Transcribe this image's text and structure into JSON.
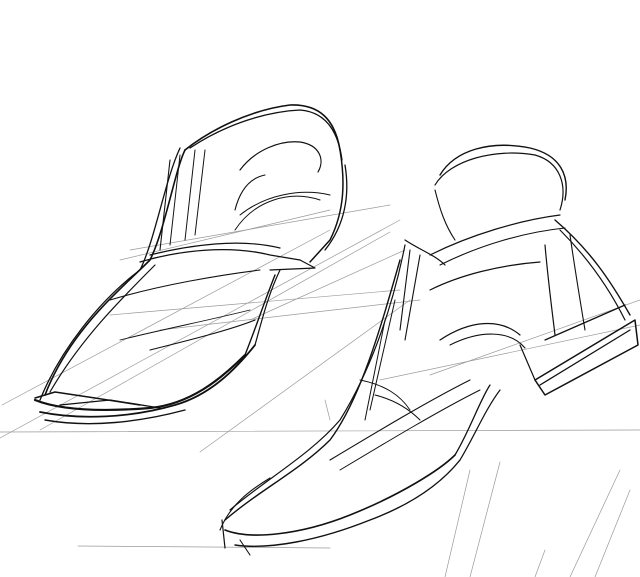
{
  "scene": {
    "background_color": "#ffffff",
    "ink_color": "#111111",
    "light_ink_color": "#888888",
    "subjects": [
      {
        "name": "left-shoe-sketch"
      },
      {
        "name": "right-shoe-sketch"
      }
    ]
  }
}
